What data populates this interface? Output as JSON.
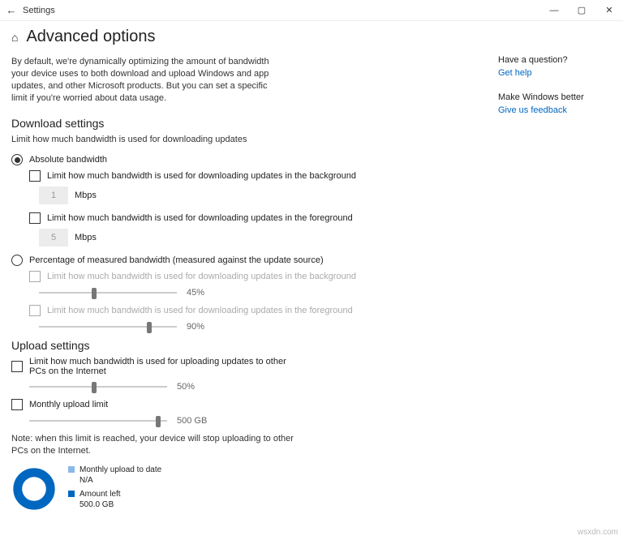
{
  "window": {
    "title": "Settings"
  },
  "page": {
    "heading": "Advanced options",
    "intro": "By default, we're dynamically optimizing the amount of bandwidth your device uses to both download and upload Windows and app updates, and other Microsoft products. But you can set a specific limit if you're worried about data usage."
  },
  "download": {
    "heading": "Download settings",
    "desc": "Limit how much bandwidth is used for downloading updates",
    "abs_label": "Absolute bandwidth",
    "bg_limit_label": "Limit how much bandwidth is used for downloading updates in the background",
    "bg_value": "1",
    "bg_unit": "Mbps",
    "fg_limit_label": "Limit how much bandwidth is used for downloading updates in the foreground",
    "fg_value": "5",
    "fg_unit": "Mbps",
    "pct_label": "Percentage of measured bandwidth (measured against the update source)",
    "pct_bg_label": "Limit how much bandwidth is used for downloading updates in the background",
    "pct_bg_value": "45%",
    "pct_fg_label": "Limit how much bandwidth is used for downloading updates in the foreground",
    "pct_fg_value": "90%"
  },
  "upload": {
    "heading": "Upload settings",
    "limit_label": "Limit how much bandwidth is used for uploading updates to other PCs on the Internet",
    "limit_value": "50%",
    "monthly_label": "Monthly upload limit",
    "monthly_value": "500 GB",
    "note": "Note: when this limit is reached, your device will stop uploading to other PCs on the Internet.",
    "legend1_title": "Monthly upload to date",
    "legend1_value": "N/A",
    "legend2_title": "Amount left",
    "legend2_value": "500.0 GB"
  },
  "side": {
    "q1": "Have a question?",
    "link1": "Get help",
    "q2": "Make Windows better",
    "link2": "Give us feedback"
  },
  "colors": {
    "accent": "#0067c0",
    "donut_light": "#8bb8e8"
  },
  "watermark": "wsxdn.com"
}
